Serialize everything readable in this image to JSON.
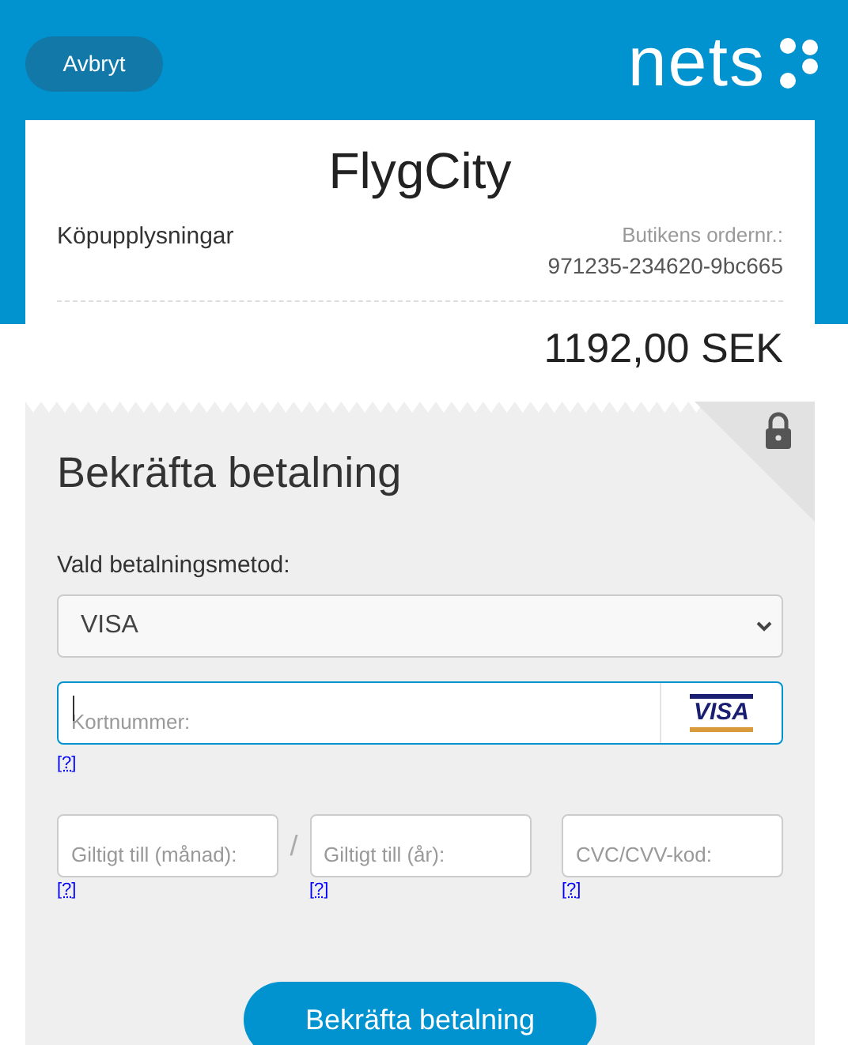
{
  "header": {
    "cancel_button": "Avbryt",
    "logo": "nets"
  },
  "merchant": {
    "name": "FlygCity",
    "info_label": "Köpupplysningar",
    "order_label": "Butikens ordernr.:",
    "order_number": "971235-234620-9bc665",
    "amount": "1192,00 SEK"
  },
  "payment": {
    "title": "Bekräfta betalning",
    "method_label": "Vald betalningsmetod:",
    "method": "VISA",
    "card_field": {
      "placeholder": "Kortnummer:",
      "focused": true,
      "brand": "VISA",
      "help": "[?]"
    },
    "fields": [
      {
        "placeholder": "Giltigt till (månad):",
        "help": "[?]"
      },
      {
        "placeholder": "Giltigt till (år):",
        "help": "[?]"
      },
      {
        "placeholder": "CVC/CVV-kod:",
        "help": "[?]"
      }
    ],
    "separator": "/",
    "submit": "Bekräfta betalning"
  }
}
